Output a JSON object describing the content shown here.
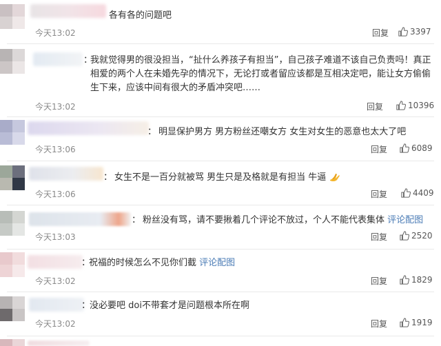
{
  "comments": [
    {
      "text": "各有各的问题吧",
      "time": "今天13:02",
      "reply": "回复",
      "likes": "3397"
    },
    {
      "prefix": "：",
      "text": "我就觉得男的很没担当，“扯什么养孩子有担当”，自己孩子难道不该自己负责吗！真正相爱的两个人在未婚先孕的情况下，无论打或者留应该都是互相决定吧，能让女方偷偷生下来，应该中间有很大的矛盾冲突吧……",
      "time": "今天13:02",
      "reply": "回复",
      "likes": "10396"
    },
    {
      "prefix": "：",
      "text": "明显保护男方 男方粉丝还嘲女方 女生对女生的恶意也太大了吧",
      "time": "今天13:06",
      "reply": "回复",
      "likes": "6089"
    },
    {
      "prefix": "：",
      "text": "女生不是一百分就被骂 男生只是及格就是有担当 牛逼",
      "time": "今天13:06",
      "reply": "回复",
      "likes": "4409",
      "emoji": "clap-emoji"
    },
    {
      "prefix": "：",
      "text": "粉丝没有骂，请不要揪着几个评论不放过，个人不能代表集体",
      "link": "评论配图",
      "time": "今天13:03",
      "reply": "回复",
      "likes": "2520"
    },
    {
      "prefix": "：",
      "text": "祝福的时候怎么不见你们截",
      "link": "评论配图",
      "time": "今天13:02",
      "reply": "回复",
      "likes": "1829"
    },
    {
      "prefix": "：",
      "text": "没必要吧 doi不带套才是问题根本所在啊",
      "time": "今天13:02",
      "reply": "回复",
      "likes": "1919"
    }
  ],
  "colors": {
    "link": "#4a7bb5",
    "time": "#8a8a8a",
    "text": "#333333"
  }
}
